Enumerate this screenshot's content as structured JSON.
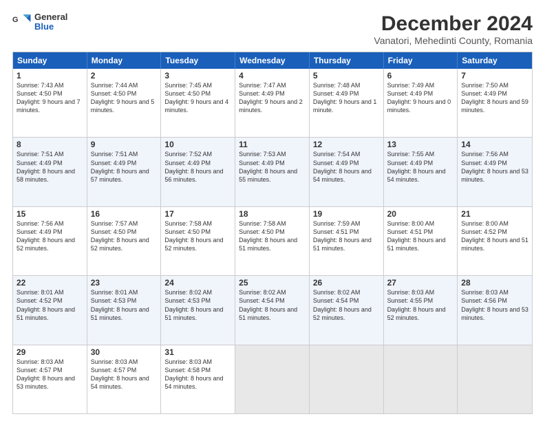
{
  "logo": {
    "general": "General",
    "blue": "Blue"
  },
  "title": "December 2024",
  "subtitle": "Vanatori, Mehedinti County, Romania",
  "header_days": [
    "Sunday",
    "Monday",
    "Tuesday",
    "Wednesday",
    "Thursday",
    "Friday",
    "Saturday"
  ],
  "weeks": [
    [
      {
        "day": "1",
        "sunrise": "7:43 AM",
        "sunset": "4:50 PM",
        "daylight": "9 hours and 7 minutes."
      },
      {
        "day": "2",
        "sunrise": "7:44 AM",
        "sunset": "4:50 PM",
        "daylight": "9 hours and 5 minutes."
      },
      {
        "day": "3",
        "sunrise": "7:45 AM",
        "sunset": "4:50 PM",
        "daylight": "9 hours and 4 minutes."
      },
      {
        "day": "4",
        "sunrise": "7:47 AM",
        "sunset": "4:49 PM",
        "daylight": "9 hours and 2 minutes."
      },
      {
        "day": "5",
        "sunrise": "7:48 AM",
        "sunset": "4:49 PM",
        "daylight": "9 hours and 1 minute."
      },
      {
        "day": "6",
        "sunrise": "7:49 AM",
        "sunset": "4:49 PM",
        "daylight": "9 hours and 0 minutes."
      },
      {
        "day": "7",
        "sunrise": "7:50 AM",
        "sunset": "4:49 PM",
        "daylight": "8 hours and 59 minutes."
      }
    ],
    [
      {
        "day": "8",
        "sunrise": "7:51 AM",
        "sunset": "4:49 PM",
        "daylight": "8 hours and 58 minutes."
      },
      {
        "day": "9",
        "sunrise": "7:51 AM",
        "sunset": "4:49 PM",
        "daylight": "8 hours and 57 minutes."
      },
      {
        "day": "10",
        "sunrise": "7:52 AM",
        "sunset": "4:49 PM",
        "daylight": "8 hours and 56 minutes."
      },
      {
        "day": "11",
        "sunrise": "7:53 AM",
        "sunset": "4:49 PM",
        "daylight": "8 hours and 55 minutes."
      },
      {
        "day": "12",
        "sunrise": "7:54 AM",
        "sunset": "4:49 PM",
        "daylight": "8 hours and 54 minutes."
      },
      {
        "day": "13",
        "sunrise": "7:55 AM",
        "sunset": "4:49 PM",
        "daylight": "8 hours and 54 minutes."
      },
      {
        "day": "14",
        "sunrise": "7:56 AM",
        "sunset": "4:49 PM",
        "daylight": "8 hours and 53 minutes."
      }
    ],
    [
      {
        "day": "15",
        "sunrise": "7:56 AM",
        "sunset": "4:49 PM",
        "daylight": "8 hours and 52 minutes."
      },
      {
        "day": "16",
        "sunrise": "7:57 AM",
        "sunset": "4:50 PM",
        "daylight": "8 hours and 52 minutes."
      },
      {
        "day": "17",
        "sunrise": "7:58 AM",
        "sunset": "4:50 PM",
        "daylight": "8 hours and 52 minutes."
      },
      {
        "day": "18",
        "sunrise": "7:58 AM",
        "sunset": "4:50 PM",
        "daylight": "8 hours and 51 minutes."
      },
      {
        "day": "19",
        "sunrise": "7:59 AM",
        "sunset": "4:51 PM",
        "daylight": "8 hours and 51 minutes."
      },
      {
        "day": "20",
        "sunrise": "8:00 AM",
        "sunset": "4:51 PM",
        "daylight": "8 hours and 51 minutes."
      },
      {
        "day": "21",
        "sunrise": "8:00 AM",
        "sunset": "4:52 PM",
        "daylight": "8 hours and 51 minutes."
      }
    ],
    [
      {
        "day": "22",
        "sunrise": "8:01 AM",
        "sunset": "4:52 PM",
        "daylight": "8 hours and 51 minutes."
      },
      {
        "day": "23",
        "sunrise": "8:01 AM",
        "sunset": "4:53 PM",
        "daylight": "8 hours and 51 minutes."
      },
      {
        "day": "24",
        "sunrise": "8:02 AM",
        "sunset": "4:53 PM",
        "daylight": "8 hours and 51 minutes."
      },
      {
        "day": "25",
        "sunrise": "8:02 AM",
        "sunset": "4:54 PM",
        "daylight": "8 hours and 51 minutes."
      },
      {
        "day": "26",
        "sunrise": "8:02 AM",
        "sunset": "4:54 PM",
        "daylight": "8 hours and 52 minutes."
      },
      {
        "day": "27",
        "sunrise": "8:03 AM",
        "sunset": "4:55 PM",
        "daylight": "8 hours and 52 minutes."
      },
      {
        "day": "28",
        "sunrise": "8:03 AM",
        "sunset": "4:56 PM",
        "daylight": "8 hours and 53 minutes."
      }
    ],
    [
      {
        "day": "29",
        "sunrise": "8:03 AM",
        "sunset": "4:57 PM",
        "daylight": "8 hours and 53 minutes."
      },
      {
        "day": "30",
        "sunrise": "8:03 AM",
        "sunset": "4:57 PM",
        "daylight": "8 hours and 54 minutes."
      },
      {
        "day": "31",
        "sunrise": "8:03 AM",
        "sunset": "4:58 PM",
        "daylight": "8 hours and 54 minutes."
      },
      null,
      null,
      null,
      null
    ]
  ]
}
